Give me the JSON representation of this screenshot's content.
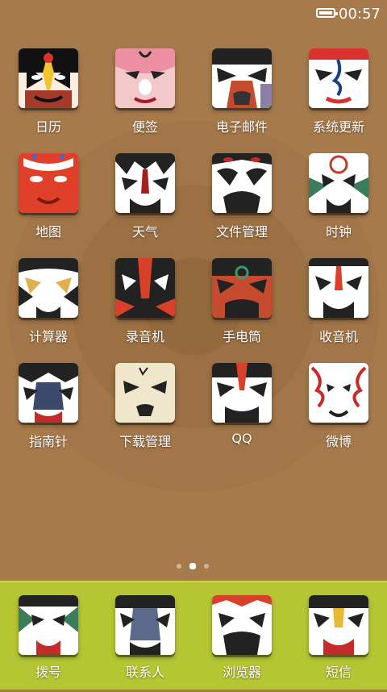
{
  "status_bar": {
    "time": "00:57",
    "battery_icon": "battery-icon"
  },
  "apps": [
    {
      "label": "日历"
    },
    {
      "label": "便签"
    },
    {
      "label": "电子邮件"
    },
    {
      "label": "系统更新"
    },
    {
      "label": "地图"
    },
    {
      "label": "天气"
    },
    {
      "label": "文件管理"
    },
    {
      "label": "时钟"
    },
    {
      "label": "计算器"
    },
    {
      "label": "录音机"
    },
    {
      "label": "手电筒"
    },
    {
      "label": "收音机"
    },
    {
      "label": "指南针"
    },
    {
      "label": "下载管理"
    },
    {
      "label": "QQ"
    },
    {
      "label": "微博"
    }
  ],
  "page_indicator": {
    "current": 2,
    "total": 3
  },
  "dock": [
    {
      "label": "拨号"
    },
    {
      "label": "联系人"
    },
    {
      "label": "浏览器"
    },
    {
      "label": "短信"
    }
  ],
  "colors": {
    "wallpaper": "#a77a4c",
    "dock": "#b6c633"
  }
}
